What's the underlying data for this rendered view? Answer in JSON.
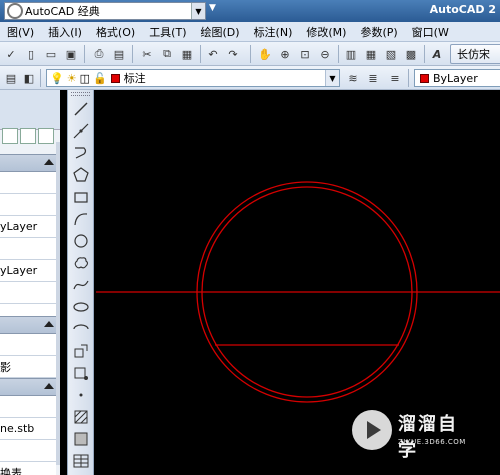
{
  "app": {
    "title": "AutoCAD 2",
    "workspace": "AutoCAD 经典"
  },
  "menu": [
    "图(V)",
    "插入(I)",
    "格式(O)",
    "工具(T)",
    "绘图(D)",
    "标注(N)",
    "修改(M)",
    "参数(P)",
    "窗口(W"
  ],
  "toolbar1": {
    "text_style": "长仿宋"
  },
  "toolbar2": {
    "layer": "标注",
    "color": "ByLayer",
    "layer_color": "#e00000"
  },
  "palette": {
    "rows": [
      "yLayer",
      "yLayer",
      "影",
      "ne.stb",
      "换表"
    ]
  },
  "drawing": {
    "line_color": "#d40000",
    "shapes": [
      "horizontal-line",
      "outer-circle",
      "inner-circle",
      "chord-line"
    ]
  },
  "watermark": {
    "brand": "溜溜自学",
    "url": "ZIXUE.3D66.COM"
  }
}
